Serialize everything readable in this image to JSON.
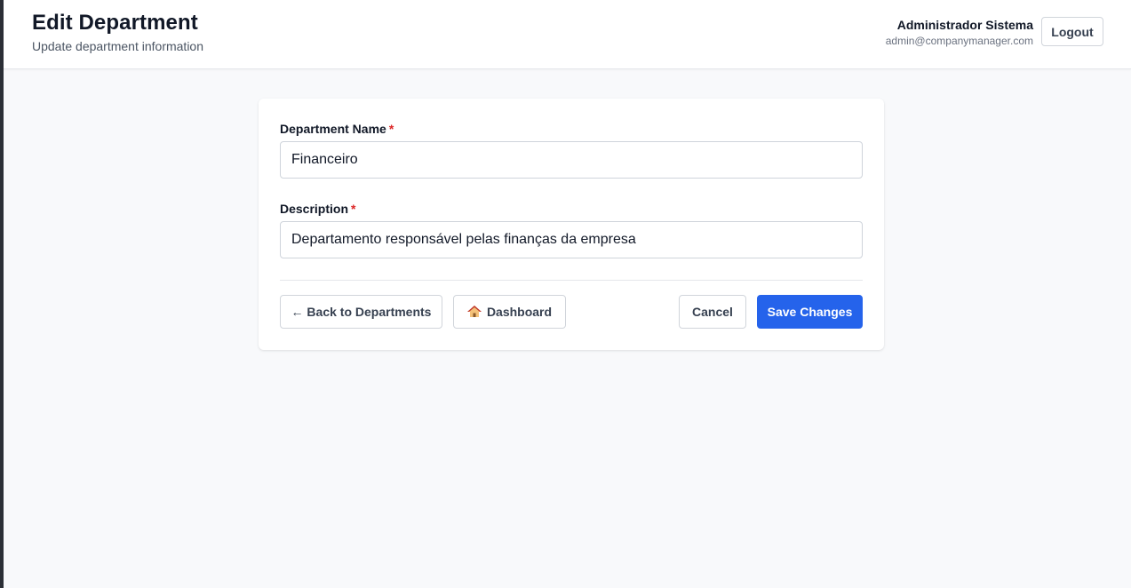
{
  "header": {
    "title": "Edit Department",
    "subtitle": "Update department information",
    "user_name": "Administrador Sistema",
    "user_email": "admin@companymanager.com",
    "logout_label": "Logout"
  },
  "form": {
    "name_label": "Department Name",
    "name_required": "*",
    "name_value": "Financeiro",
    "description_label": "Description",
    "description_required": "*",
    "description_value": "Departamento responsável pelas finanças da empresa"
  },
  "actions": {
    "back_label": "← Back to Departments",
    "dashboard_label": "Dashboard",
    "dashboard_icon": "house-icon",
    "cancel_label": "Cancel",
    "save_label": "Save Changes"
  },
  "colors": {
    "primary": "#2563eb",
    "required": "#dc2626",
    "background": "#f8f9fb"
  }
}
